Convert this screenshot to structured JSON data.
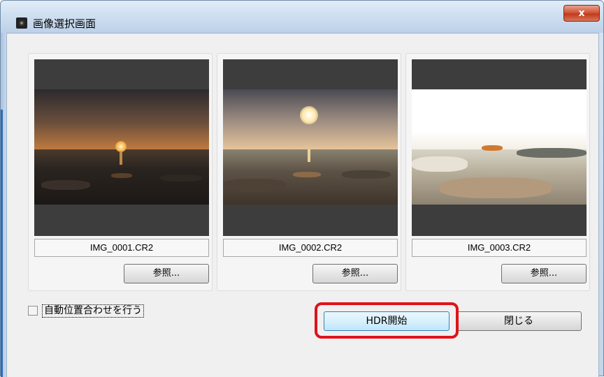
{
  "window": {
    "title": "画像選択画面",
    "close_label": "x"
  },
  "images": [
    {
      "filename": "IMG_0001.CR2",
      "browse_label": "参照..."
    },
    {
      "filename": "IMG_0002.CR2",
      "browse_label": "参照..."
    },
    {
      "filename": "IMG_0003.CR2",
      "browse_label": "参照..."
    }
  ],
  "auto_align": {
    "label": "自動位置合わせを行う",
    "checked": false
  },
  "buttons": {
    "hdr_start": "HDR開始",
    "close": "閉じる"
  },
  "colors": {
    "highlight": "#e0121a",
    "thumb_bg": "#3d3d3d"
  }
}
